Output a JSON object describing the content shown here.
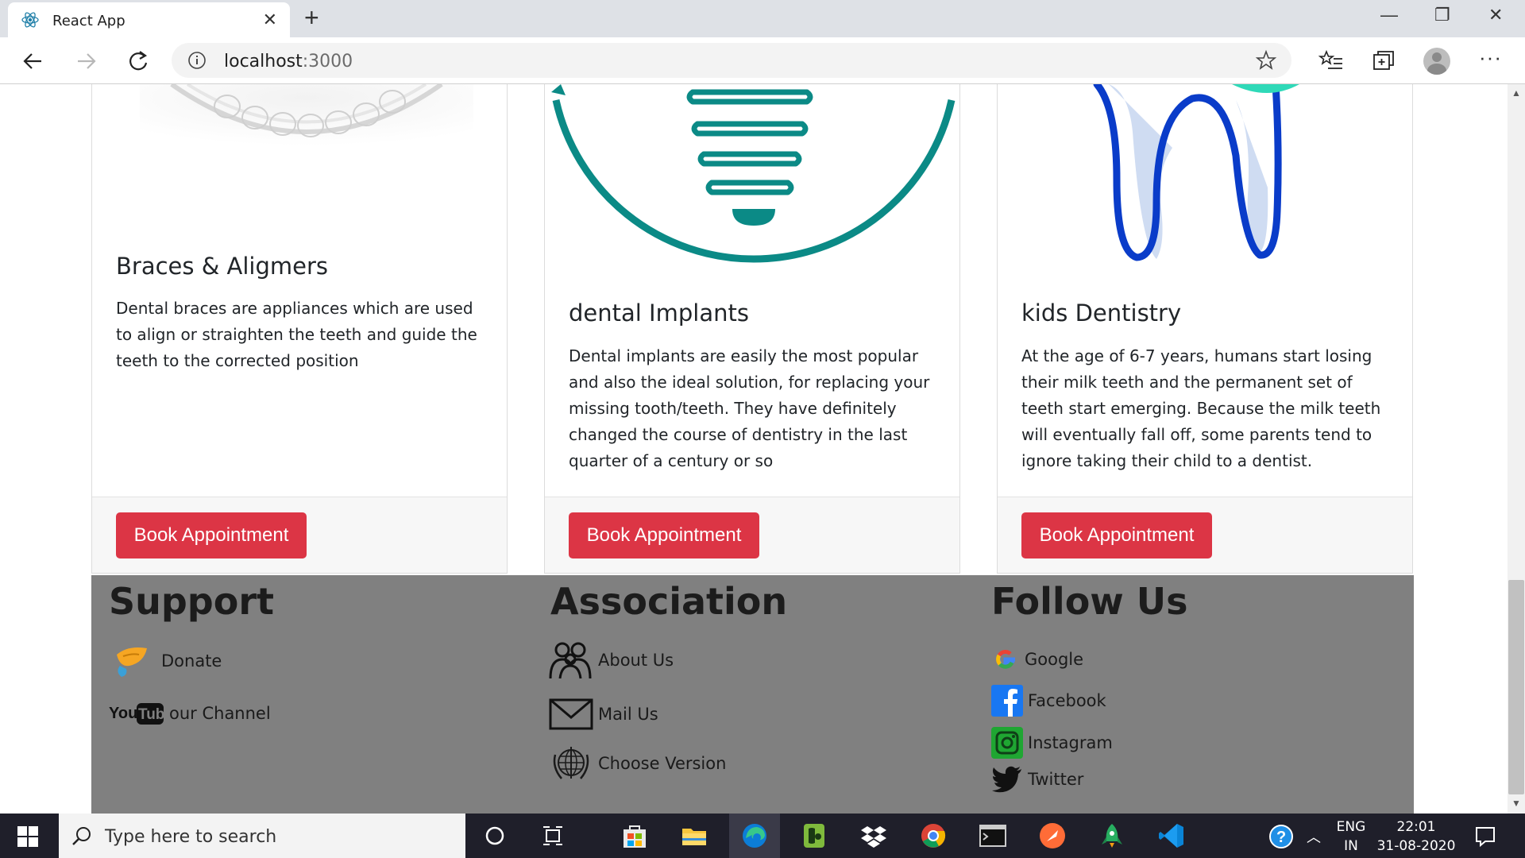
{
  "browser": {
    "tab_title": "React App",
    "url_host": "localhost",
    "url_port": ":3000"
  },
  "cards": [
    {
      "title": "Braces & Aligmers",
      "text": "Dental braces are appliances which are used to align or straighten the teeth and guide the teeth to the corrected position",
      "button": "Book Appointment"
    },
    {
      "title": "dental Implants",
      "text": "Dental implants are easily the most popular and also the ideal solution, for replacing your missing tooth/teeth. They have definitely changed the course of dentistry in the last quarter of a century or so",
      "button": "Book Appointment"
    },
    {
      "title": "kids Dentistry",
      "text": "At the age of 6-7 years, humans start losing their milk teeth and the permanent set of teeth start emerging. Because the milk teeth will eventually fall off, some parents tend to ignore taking their child to a dentist.",
      "button": "Book Appointment"
    }
  ],
  "footer": {
    "support": {
      "title": "Support",
      "links": [
        {
          "label": "Donate",
          "icon": "donate-icon"
        },
        {
          "label": "our Channel",
          "icon": "youtube-icon",
          "logo_text": "YouTube"
        }
      ]
    },
    "association": {
      "title": "Association",
      "links": [
        {
          "label": "About Us",
          "icon": "people-icon"
        },
        {
          "label": "Mail Us",
          "icon": "mail-icon"
        },
        {
          "label": "Choose Version",
          "icon": "globe-emblem-icon"
        }
      ]
    },
    "follow": {
      "title": "Follow Us",
      "links": [
        {
          "label": "Google",
          "icon": "google-icon"
        },
        {
          "label": "Facebook",
          "icon": "facebook-icon"
        },
        {
          "label": "Instagram",
          "icon": "instagram-icon"
        },
        {
          "label": "Twitter",
          "icon": "twitter-icon"
        }
      ]
    }
  },
  "taskbar": {
    "search_placeholder": "Type here to search",
    "lang_1": "ENG",
    "lang_2": "IN",
    "time": "22:01",
    "date": "31-08-2020"
  },
  "colors": {
    "button": "#dc3545",
    "footer_bg": "#808080",
    "implant_teal": "#0b8a86",
    "tooth_blue": "#0a3cc9"
  }
}
